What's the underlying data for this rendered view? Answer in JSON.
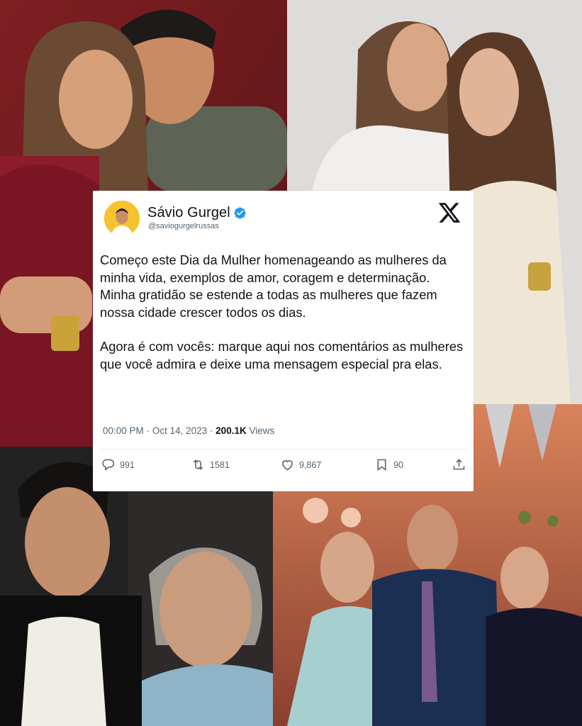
{
  "tweet": {
    "display_name": "Sávio Gurgel",
    "handle": "@saviogurgelrussas",
    "paragraph1": "Começo este Dia da Mulher homenageando as mulheres da minha vida, exemplos de amor, coragem e determinação. Minha gratidão se estende a todas as mulheres que fazem nossa cidade crescer todos os dias.",
    "paragraph2": "Agora é com vocês: marque aqui nos comentários as mulheres que você admira e deixe uma mensagem especial pra elas.",
    "time": "00:00 PM",
    "separator": "·",
    "date": "Oct 14, 2023",
    "views_count": "200.1K",
    "views_label": "Views",
    "replies": "991",
    "retweets": "1581",
    "likes": "9,867",
    "bookmarks": "90"
  },
  "icons": {
    "verified": "verified-badge-icon",
    "platform": "x-logo-icon",
    "reply": "reply-icon",
    "retweet": "retweet-icon",
    "like": "heart-icon",
    "bookmark": "bookmark-icon",
    "share": "share-icon"
  },
  "colors": {
    "verified_blue": "#1d9bf0",
    "text_primary": "#0f1419",
    "text_secondary": "#536471",
    "avatar_yellow": "#f6c22d"
  }
}
